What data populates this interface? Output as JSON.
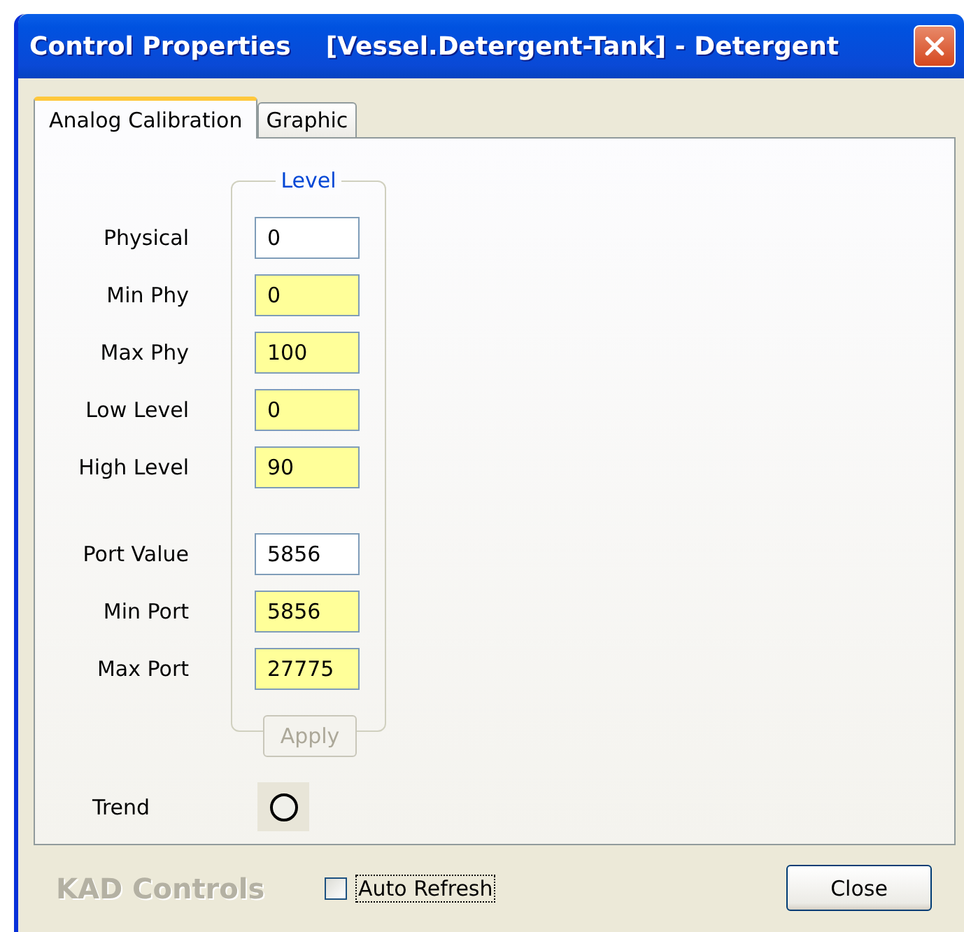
{
  "window": {
    "title": "Control Properties    [Vessel.Detergent-Tank] - Detergent"
  },
  "tabs": [
    {
      "label": "Analog Calibration",
      "selected": true
    },
    {
      "label": "Graphic",
      "selected": false
    }
  ],
  "group": {
    "legend": "Level"
  },
  "physical_fields": [
    {
      "label": "Physical",
      "value": "0",
      "kind": "readonly"
    },
    {
      "label": "Min Phy",
      "value": "0",
      "kind": "editable"
    },
    {
      "label": "Max Phy",
      "value": "100",
      "kind": "editable"
    },
    {
      "label": "Low Level",
      "value": "0",
      "kind": "editable"
    },
    {
      "label": "High Level",
      "value": "90",
      "kind": "editable"
    }
  ],
  "port_fields": [
    {
      "label": "Port Value",
      "value": "5856",
      "kind": "readonly"
    },
    {
      "label": "Min Port",
      "value": "5856",
      "kind": "editable"
    },
    {
      "label": "Max Port",
      "value": "27775",
      "kind": "editable"
    }
  ],
  "apply_button": {
    "label": "Apply",
    "disabled": true
  },
  "trend": {
    "label": "Trend",
    "on": false
  },
  "footer": {
    "brand": "KAD Controls",
    "auto_refresh": {
      "label": "Auto Refresh",
      "checked": false,
      "focused": true
    },
    "close_button": "Close"
  }
}
